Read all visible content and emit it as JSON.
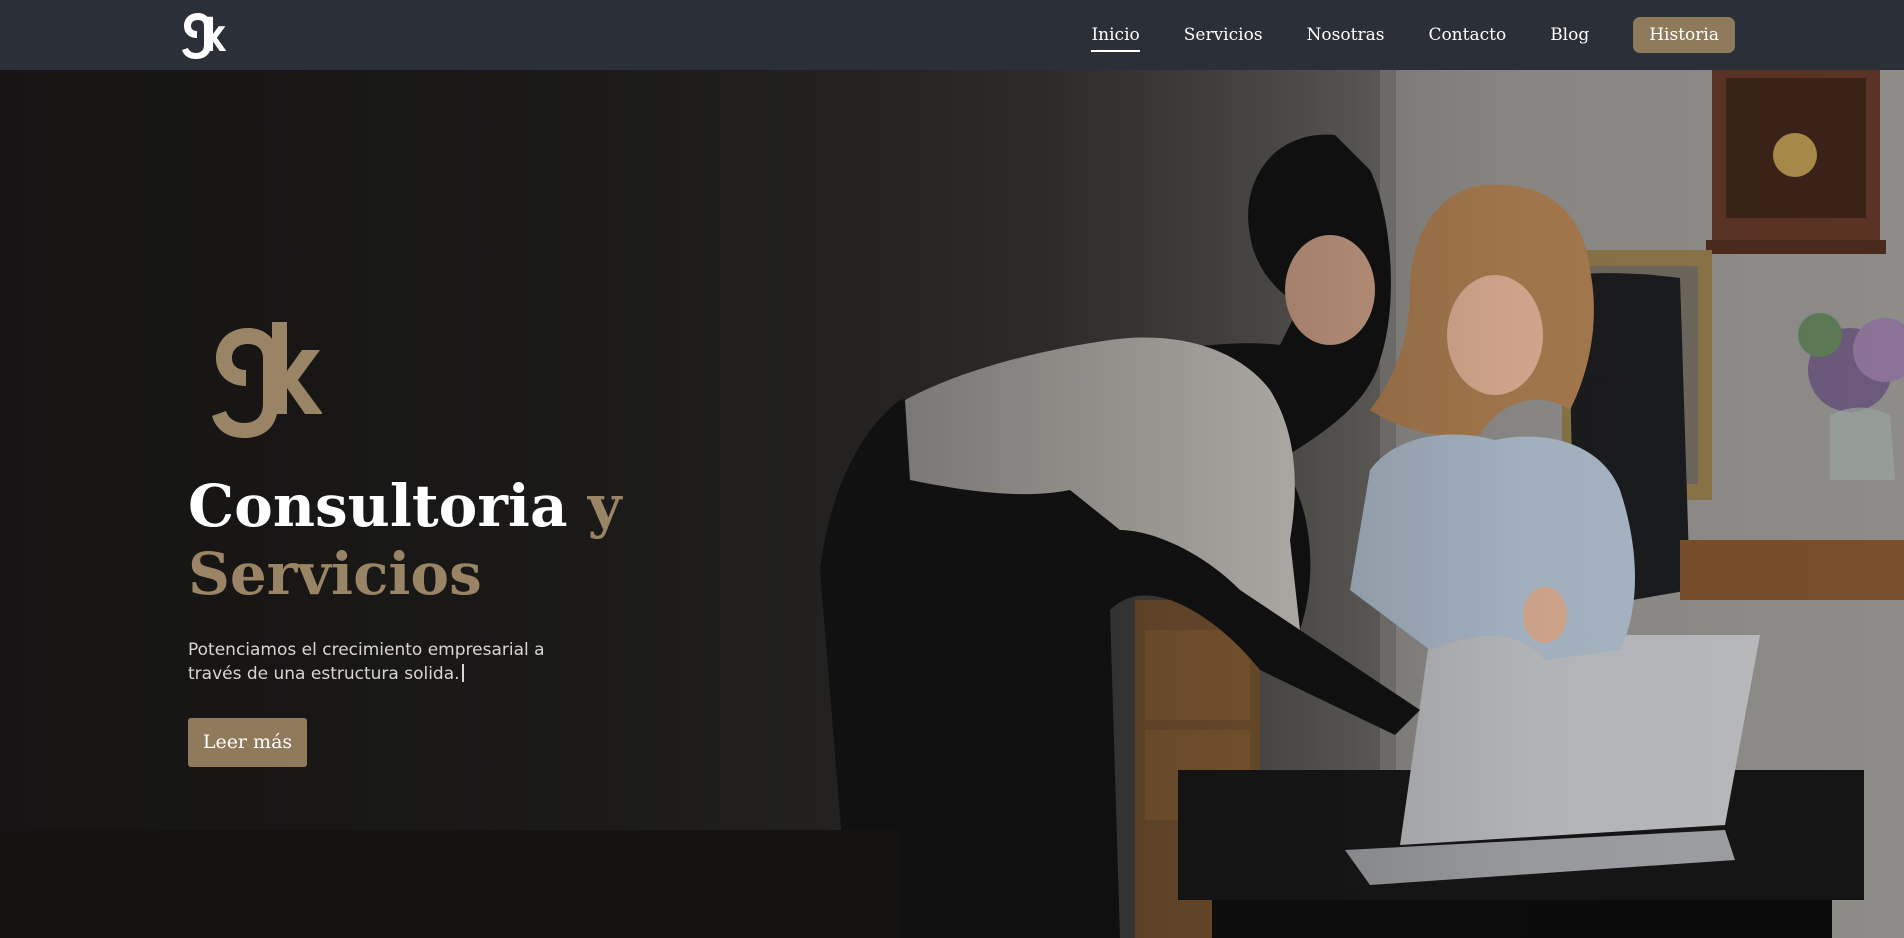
{
  "nav": {
    "logo_alt": "gk",
    "items": [
      {
        "label": "Inicio",
        "active": true
      },
      {
        "label": "Servicios"
      },
      {
        "label": "Nosotras"
      },
      {
        "label": "Contacto"
      },
      {
        "label": "Blog"
      }
    ],
    "cta_label": "Historia"
  },
  "hero": {
    "title_main": "Consultoria",
    "title_accent_y": "y",
    "title_accent_line2": "Servicios",
    "subtitle": "Potenciamos el crecimiento empresarial a través de una estructura solida.",
    "button_label": "Leer más"
  },
  "colors": {
    "nav_bg": "#2b2f37",
    "accent": "#8f7a5c",
    "accent_text": "#9a8466",
    "text_light": "#ffffff"
  },
  "icons": {
    "nav_logo": "gk-logo-icon",
    "hero_logo": "gk-logo-icon"
  }
}
